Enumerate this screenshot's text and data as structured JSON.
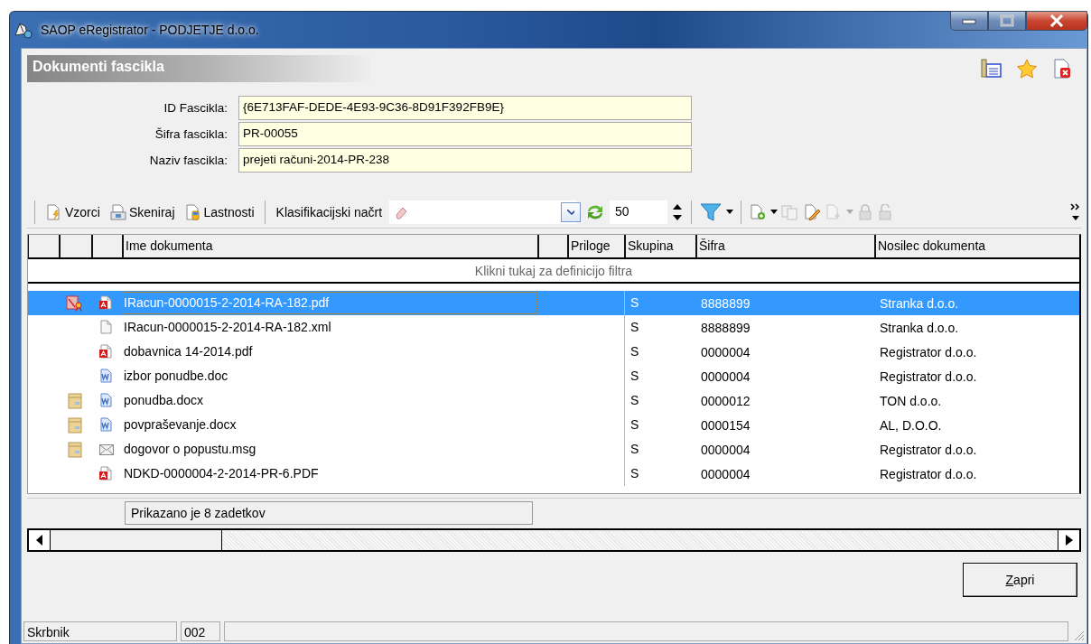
{
  "window": {
    "title": "SAOP eRegistrator - PODJETJE d.o.o."
  },
  "panel": {
    "title": "Dokumenti fascikla"
  },
  "fields": [
    {
      "label": "ID Fascikla:",
      "value": "{6E713FAF-DEDE-4E93-9C36-8D91F392FB9E}"
    },
    {
      "label": "Šifra fascikla:",
      "value": "PR-00055"
    },
    {
      "label": "Naziv fascikla:",
      "value": "prejeti računi-2014-PR-238"
    }
  ],
  "toolbar": {
    "buttons": [
      "Vzorci",
      "Skeniraj",
      "Lastnosti"
    ],
    "classification_label": "Klasifikacijski načrt",
    "page_size": "50",
    "actions": [
      {
        "disabled": false
      },
      {
        "disabled": true
      },
      {
        "disabled": false
      },
      {
        "disabled": true
      },
      {
        "disabled": true
      },
      {
        "disabled": true
      }
    ]
  },
  "table": {
    "columns": [
      "Ime dokumenta",
      "Priloge",
      "Skupina",
      "Šifra",
      "Nosilec dokumenta"
    ],
    "filter_hint": "Klikni tukaj za definicijo filtra",
    "rows": [
      {
        "signed": true,
        "archived": false,
        "kind": "pdf",
        "name": "IRacun-0000015-2-2014-RA-182.pdf",
        "group": "S",
        "code": "8888899",
        "holder": "Stranka d.o.o.",
        "selected": true
      },
      {
        "signed": false,
        "archived": false,
        "kind": "file",
        "name": "IRacun-0000015-2-2014-RA-182.xml",
        "group": "S",
        "code": "8888899",
        "holder": "Stranka d.o.o.",
        "selected": false
      },
      {
        "signed": false,
        "archived": false,
        "kind": "pdf",
        "name": "dobavnica 14-2014.pdf",
        "group": "S",
        "code": "0000004",
        "holder": "Registrator d.o.o.",
        "selected": false
      },
      {
        "signed": false,
        "archived": false,
        "kind": "word",
        "name": "izbor ponudbe.doc",
        "group": "S",
        "code": "0000004",
        "holder": "Registrator d.o.o.",
        "selected": false
      },
      {
        "signed": false,
        "archived": true,
        "kind": "word",
        "name": "ponudba.docx",
        "group": "S",
        "code": "0000012",
        "holder": "TON d.o.o.",
        "selected": false
      },
      {
        "signed": false,
        "archived": true,
        "kind": "word",
        "name": "povpraševanje.docx",
        "group": "S",
        "code": "0000154",
        "holder": "AL, D.O.O.",
        "selected": false
      },
      {
        "signed": false,
        "archived": true,
        "kind": "mail",
        "name": "dogovor o popustu.msg",
        "group": "S",
        "code": "0000004",
        "holder": "Registrator d.o.o.",
        "selected": false
      },
      {
        "signed": false,
        "archived": false,
        "kind": "pdf",
        "name": "NDKD-0000004-2-2014-PR-6.PDF",
        "group": "S",
        "code": "0000004",
        "holder": "Registrator d.o.o.",
        "selected": false
      }
    ]
  },
  "result_count": "Prikazano je 8 zadetkov",
  "buttons": [
    "Zapri"
  ],
  "status_bar": [
    "Skrbnik",
    "002"
  ]
}
